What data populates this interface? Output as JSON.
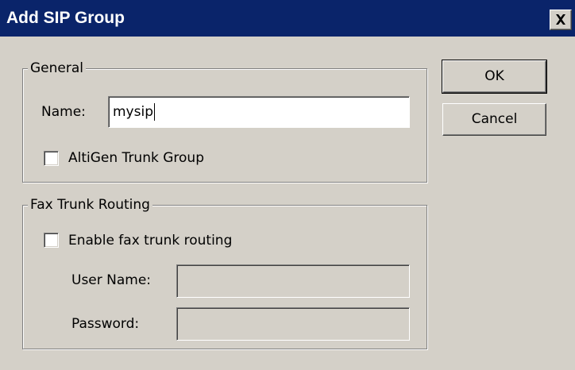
{
  "window": {
    "title": "Add SIP Group",
    "close_icon": "close-icon"
  },
  "general": {
    "legend": "General",
    "name_label": "Name:",
    "name_value": "mysip",
    "altigen_trunk_label": "AltiGen Trunk Group",
    "altigen_trunk_checked": false
  },
  "fax": {
    "legend": "Fax Trunk Routing",
    "enable_label": "Enable fax trunk routing",
    "enable_checked": false,
    "username_label": "User Name:",
    "username_value": "",
    "password_label": "Password:",
    "password_value": ""
  },
  "buttons": {
    "ok_label": "OK",
    "cancel_label": "Cancel"
  },
  "colors": {
    "titlebar": "#0a246a",
    "face": "#d4d0c8"
  }
}
